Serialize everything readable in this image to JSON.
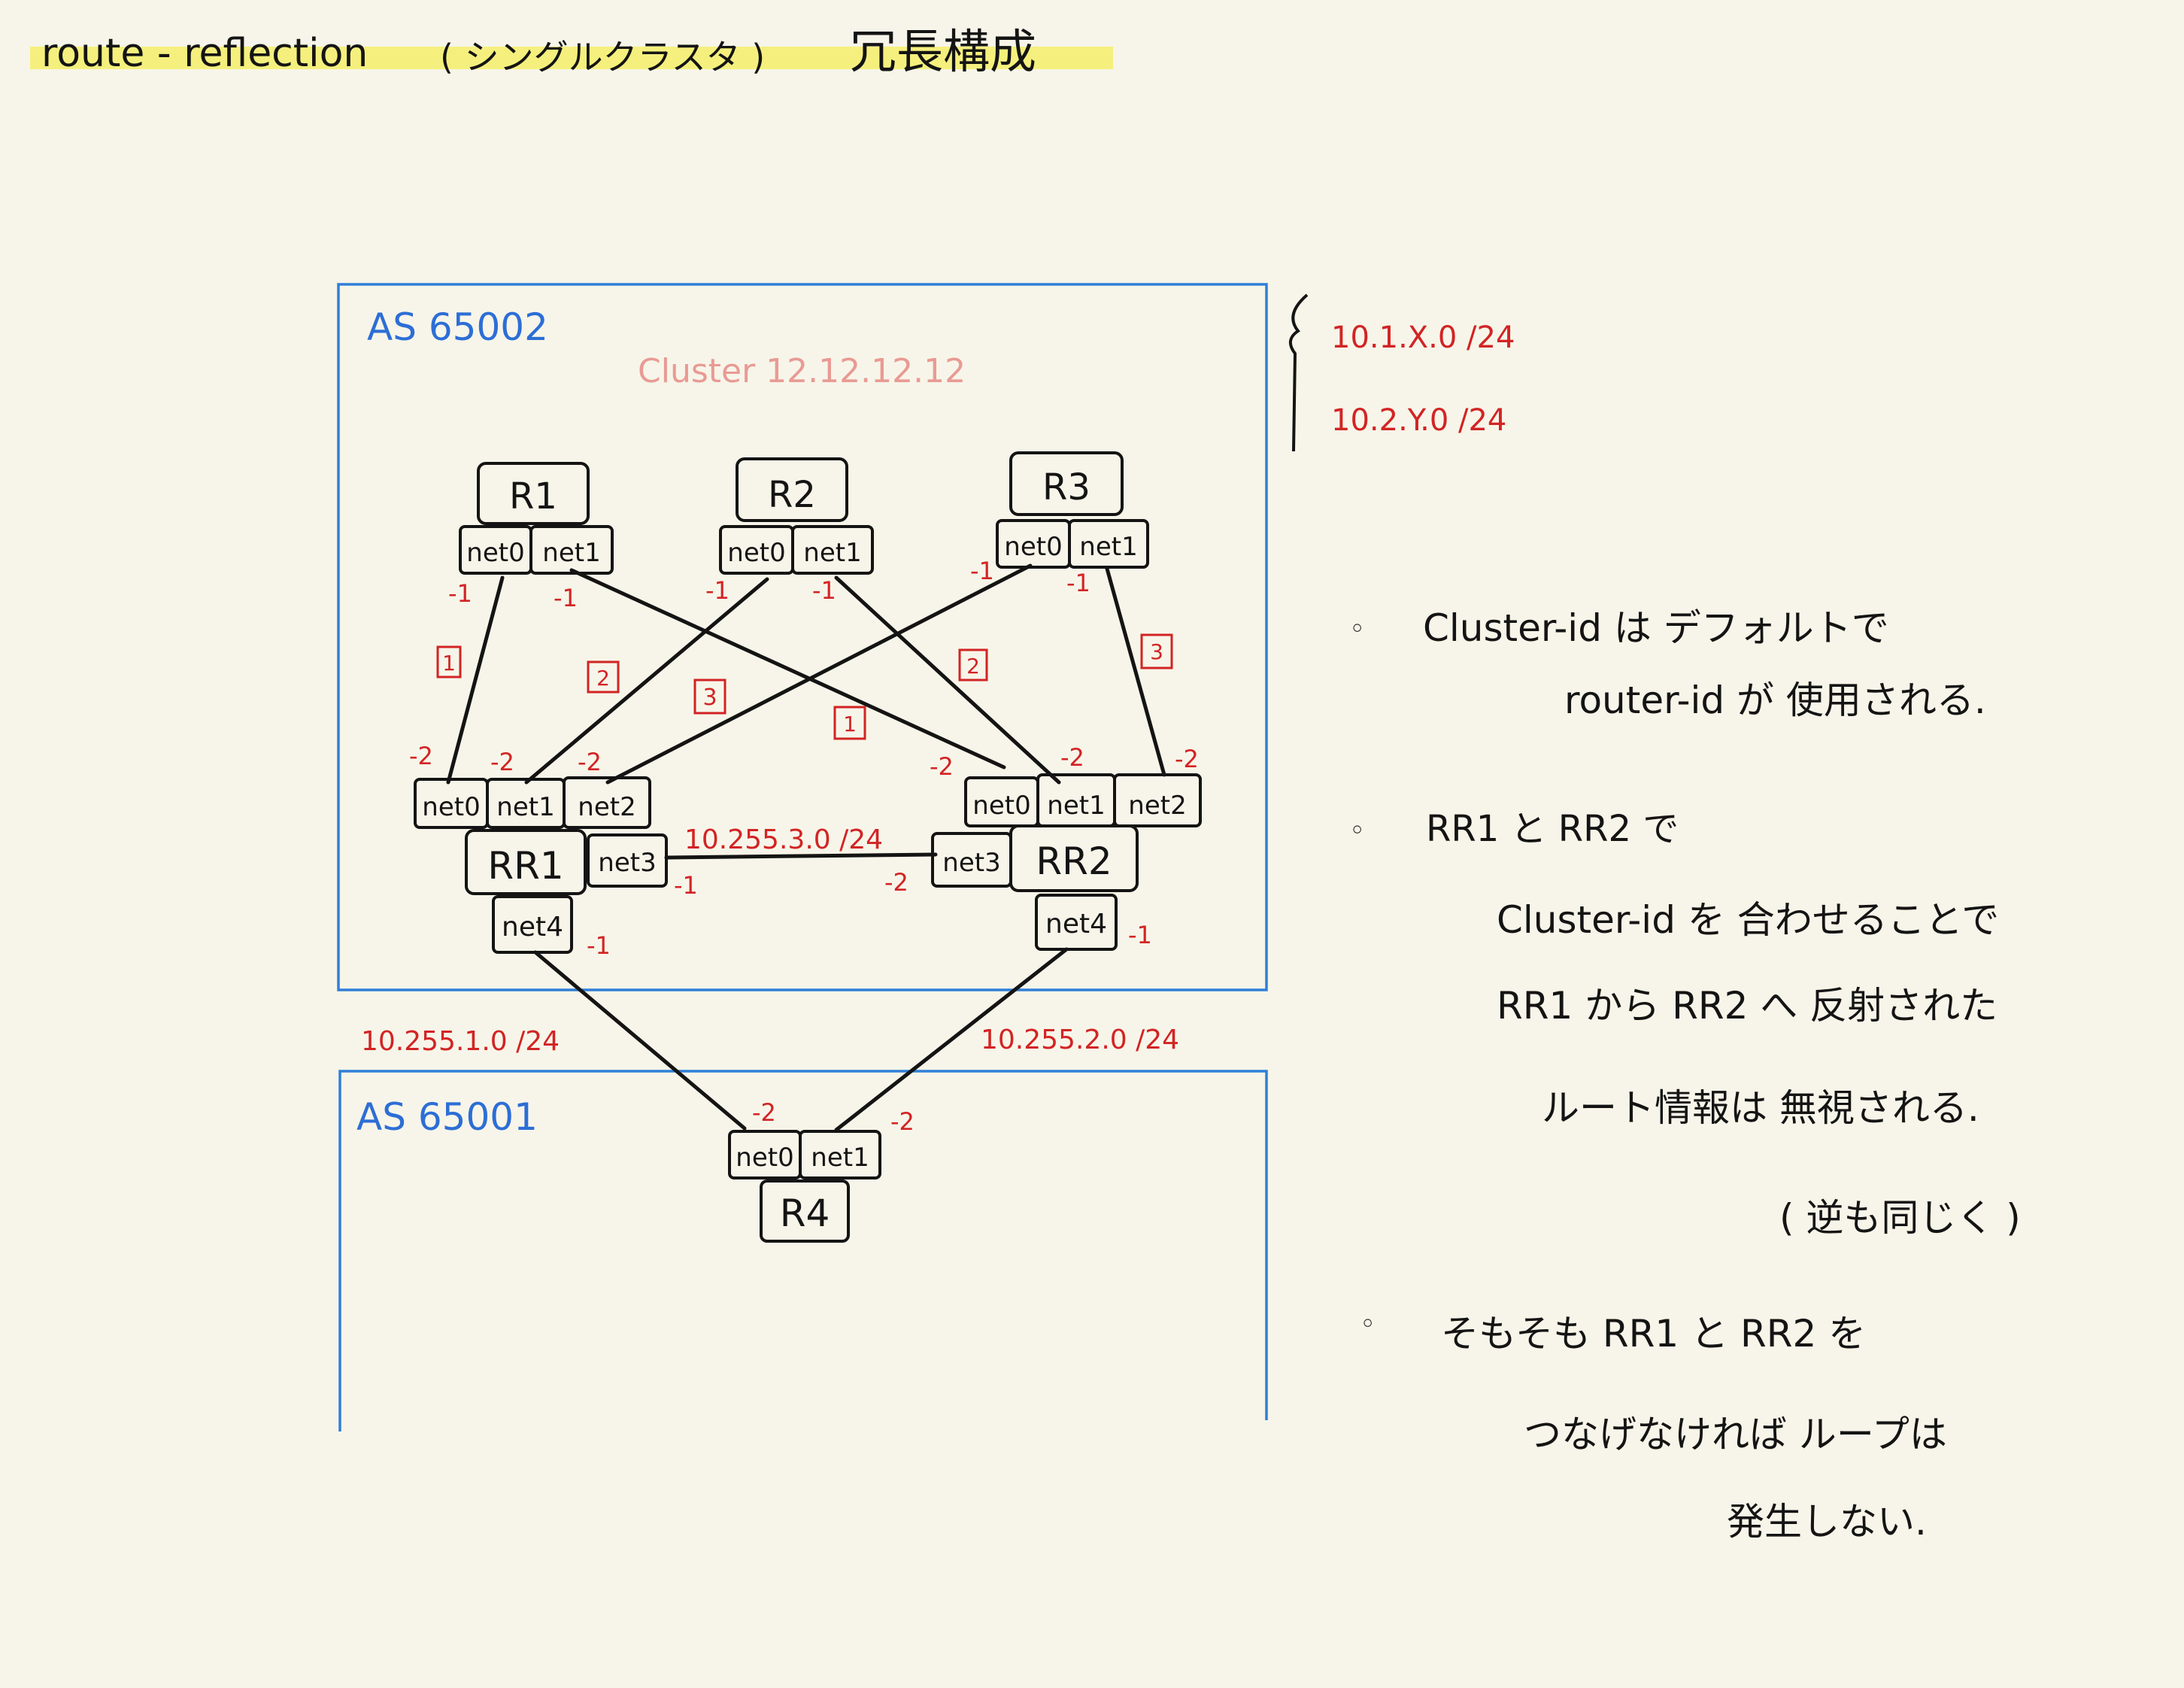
{
  "title": {
    "prefix": "route - reflection",
    "paren": "( シングルクラスタ )",
    "suffix": "冗長構成"
  },
  "colors": {
    "ink": "#141414",
    "red": "#d22424",
    "blue": "#2f7fd8",
    "pink": "#e99a94",
    "highlight": "#f5ee6a",
    "paper": "#f7f5e9"
  },
  "as_top": {
    "label": "AS 65002",
    "cluster_label": "Cluster 12.12.12.12"
  },
  "as_bottom": {
    "label": "AS 65001"
  },
  "subnet_notes": [
    "10.1.X.0 /24",
    "10.2.Y.0 /24"
  ],
  "routers": {
    "r1": {
      "label": "R1",
      "ifaces": [
        "net0",
        "net1"
      ],
      "addr": [
        "-1",
        "-1"
      ]
    },
    "r2": {
      "label": "R2",
      "ifaces": [
        "net0",
        "net1"
      ],
      "addr": [
        "-1",
        "-1"
      ]
    },
    "r3": {
      "label": "R3",
      "ifaces": [
        "net0",
        "net1"
      ],
      "addr": [
        "-1",
        "-1"
      ]
    },
    "rr1": {
      "label": "RR1",
      "ifaces": [
        "net0",
        "net1",
        "net2",
        "net3",
        "net4"
      ],
      "addr": [
        "-2",
        "-2",
        "-2",
        "-1",
        "-1"
      ]
    },
    "rr2": {
      "label": "RR2",
      "ifaces": [
        "net0",
        "net1",
        "net2",
        "net3",
        "net4"
      ],
      "addr": [
        "-2",
        "-2",
        "-2",
        "-2",
        "-1"
      ]
    },
    "r4": {
      "label": "R4",
      "ifaces": [
        "net0",
        "net1"
      ],
      "addr": [
        "-2",
        "-2"
      ]
    }
  },
  "link_numbers": [
    "1",
    "2",
    "3",
    "1",
    "2",
    "3"
  ],
  "subnets": {
    "rr_link": "10.255.3.0 /24",
    "rr1_r4": "10.255.1.0 /24",
    "rr2_r4": "10.255.2.0 /24"
  },
  "notes": [
    {
      "bullet": "◦",
      "lines": [
        "Cluster-id は デフォルトで",
        "router-id が 使用される."
      ]
    },
    {
      "bullet": "◦",
      "lines": [
        "RR1 と RR2 で",
        "Cluster-id を 合わせることで",
        "RR1 から RR2 へ 反射された",
        "ルート情報は 無視される.",
        "( 逆も同じく )"
      ]
    },
    {
      "bullet": "◦",
      "lines": [
        "そもそも RR1 と RR2 を",
        "つなげなければ ループは",
        "発生しない."
      ]
    }
  ]
}
